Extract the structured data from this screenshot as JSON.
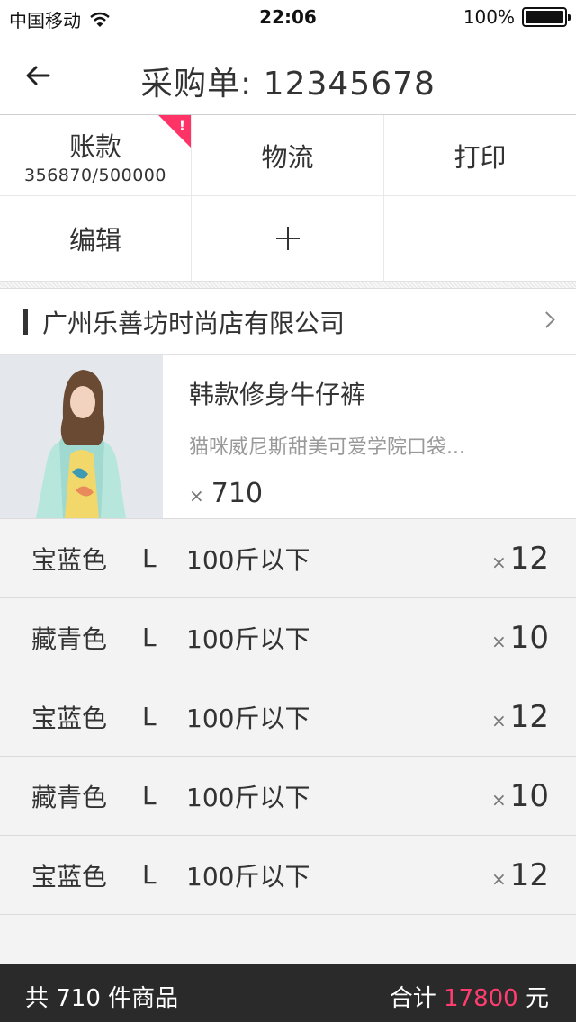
{
  "status_bar": {
    "carrier": "中国移动",
    "time": "22:06",
    "battery": "100%",
    "battery_level": 1.0
  },
  "nav": {
    "back_icon": "back-arrow-icon",
    "title": "采购单: 12345678"
  },
  "grid": {
    "account_label": "账款",
    "account_value": "356870/500000",
    "account_badge": "!",
    "logistics_label": "物流",
    "print_label": "打印",
    "edit_label": "编辑",
    "add_icon": "plus-icon"
  },
  "shop": {
    "name": "广州乐善坊时尚店有限公司",
    "chevron_icon": "chevron-right-icon"
  },
  "product": {
    "name": "韩款修身牛仔裤",
    "description": "猫咪威尼斯甜美可爱学院口袋...",
    "times": "×",
    "quantity": "710"
  },
  "variants": [
    {
      "color": "宝蓝色",
      "size": "L",
      "weight": "100斤以下",
      "times": "×",
      "qty": "12"
    },
    {
      "color": "藏青色",
      "size": "L",
      "weight": "100斤以下",
      "times": "×",
      "qty": "10"
    },
    {
      "color": "宝蓝色",
      "size": "L",
      "weight": "100斤以下",
      "times": "×",
      "qty": "12"
    },
    {
      "color": "藏青色",
      "size": "L",
      "weight": "100斤以下",
      "times": "×",
      "qty": "10"
    },
    {
      "color": "宝蓝色",
      "size": "L",
      "weight": "100斤以下",
      "times": "×",
      "qty": "12"
    }
  ],
  "footer": {
    "summary": "共 710 件商品",
    "total_label": "合计",
    "total_amount": "17800",
    "currency": "元"
  },
  "colors": {
    "accent": "#ff3d6e",
    "badge": "#ff3366",
    "footer_bg": "#2a2a2a"
  }
}
